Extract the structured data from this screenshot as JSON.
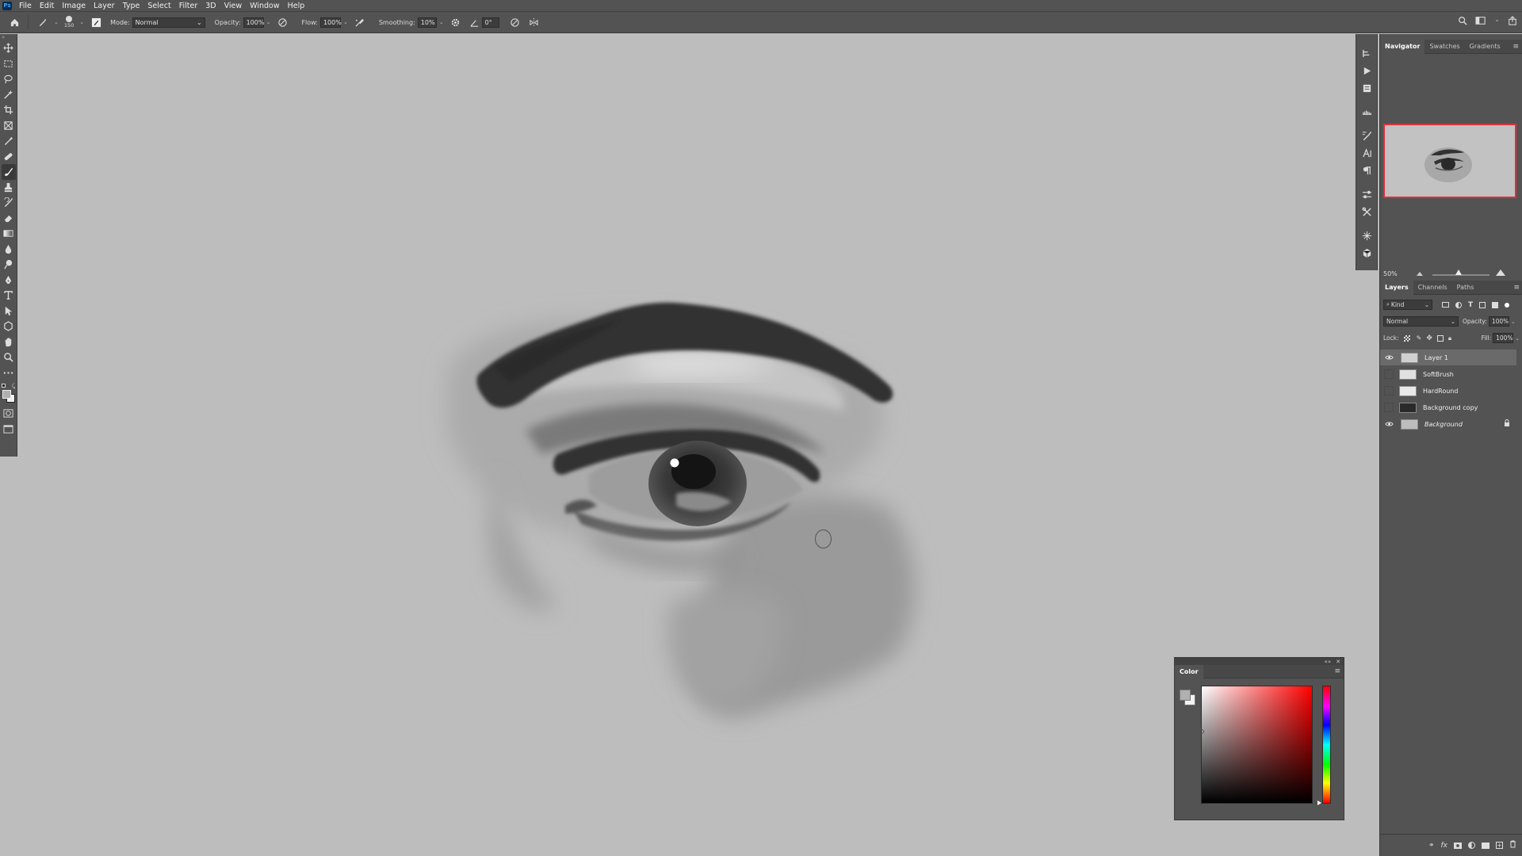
{
  "menubar": {
    "logo": "Ps",
    "items": [
      "File",
      "Edit",
      "Image",
      "Layer",
      "Type",
      "Select",
      "Filter",
      "3D",
      "View",
      "Window",
      "Help"
    ]
  },
  "options": {
    "brush_size": "150",
    "mode_label": "Mode:",
    "mode_value": "Normal",
    "opacity_label": "Opacity:",
    "opacity_value": "100%",
    "flow_label": "Flow:",
    "flow_value": "100%",
    "smoothing_label": "Smoothing:",
    "smoothing_value": "10%",
    "angle_value": "0°"
  },
  "navigator": {
    "tabs": [
      "Navigator",
      "Swatches",
      "Gradients"
    ],
    "zoom": "50%"
  },
  "layers": {
    "tabs": [
      "Layers",
      "Channels",
      "Paths"
    ],
    "filter_kind": "Kind",
    "blend_mode": "Normal",
    "opacity_label": "Opacity:",
    "opacity_value": "100%",
    "lock_label": "Lock:",
    "fill_label": "Fill:",
    "fill_value": "100%",
    "items": [
      {
        "name": "Layer 1",
        "visible": true,
        "selected": true
      },
      {
        "name": "SoftBrush",
        "visible": false,
        "selected": false
      },
      {
        "name": "HardRound",
        "visible": false,
        "selected": false
      },
      {
        "name": "Background copy",
        "visible": false,
        "selected": false
      },
      {
        "name": "Background",
        "visible": true,
        "selected": false,
        "locked": true
      }
    ]
  },
  "color_panel": {
    "title": "Color",
    "foreground": "#b0b0b0",
    "background": "#f2f2f2",
    "hue": "#ff0000"
  },
  "icons": {
    "toolbar": [
      "move-icon",
      "marquee-icon",
      "lasso-icon",
      "magic-wand-icon",
      "crop-icon",
      "frame-icon",
      "eyedropper-icon",
      "healing-icon",
      "brush-icon",
      "clone-stamp-icon",
      "history-brush-icon",
      "eraser-icon",
      "gradient-icon",
      "blur-icon",
      "dodge-icon",
      "pen-icon",
      "type-icon",
      "path-selection-icon",
      "shape-icon",
      "hand-icon",
      "zoom-icon",
      "more-tools-icon"
    ]
  }
}
